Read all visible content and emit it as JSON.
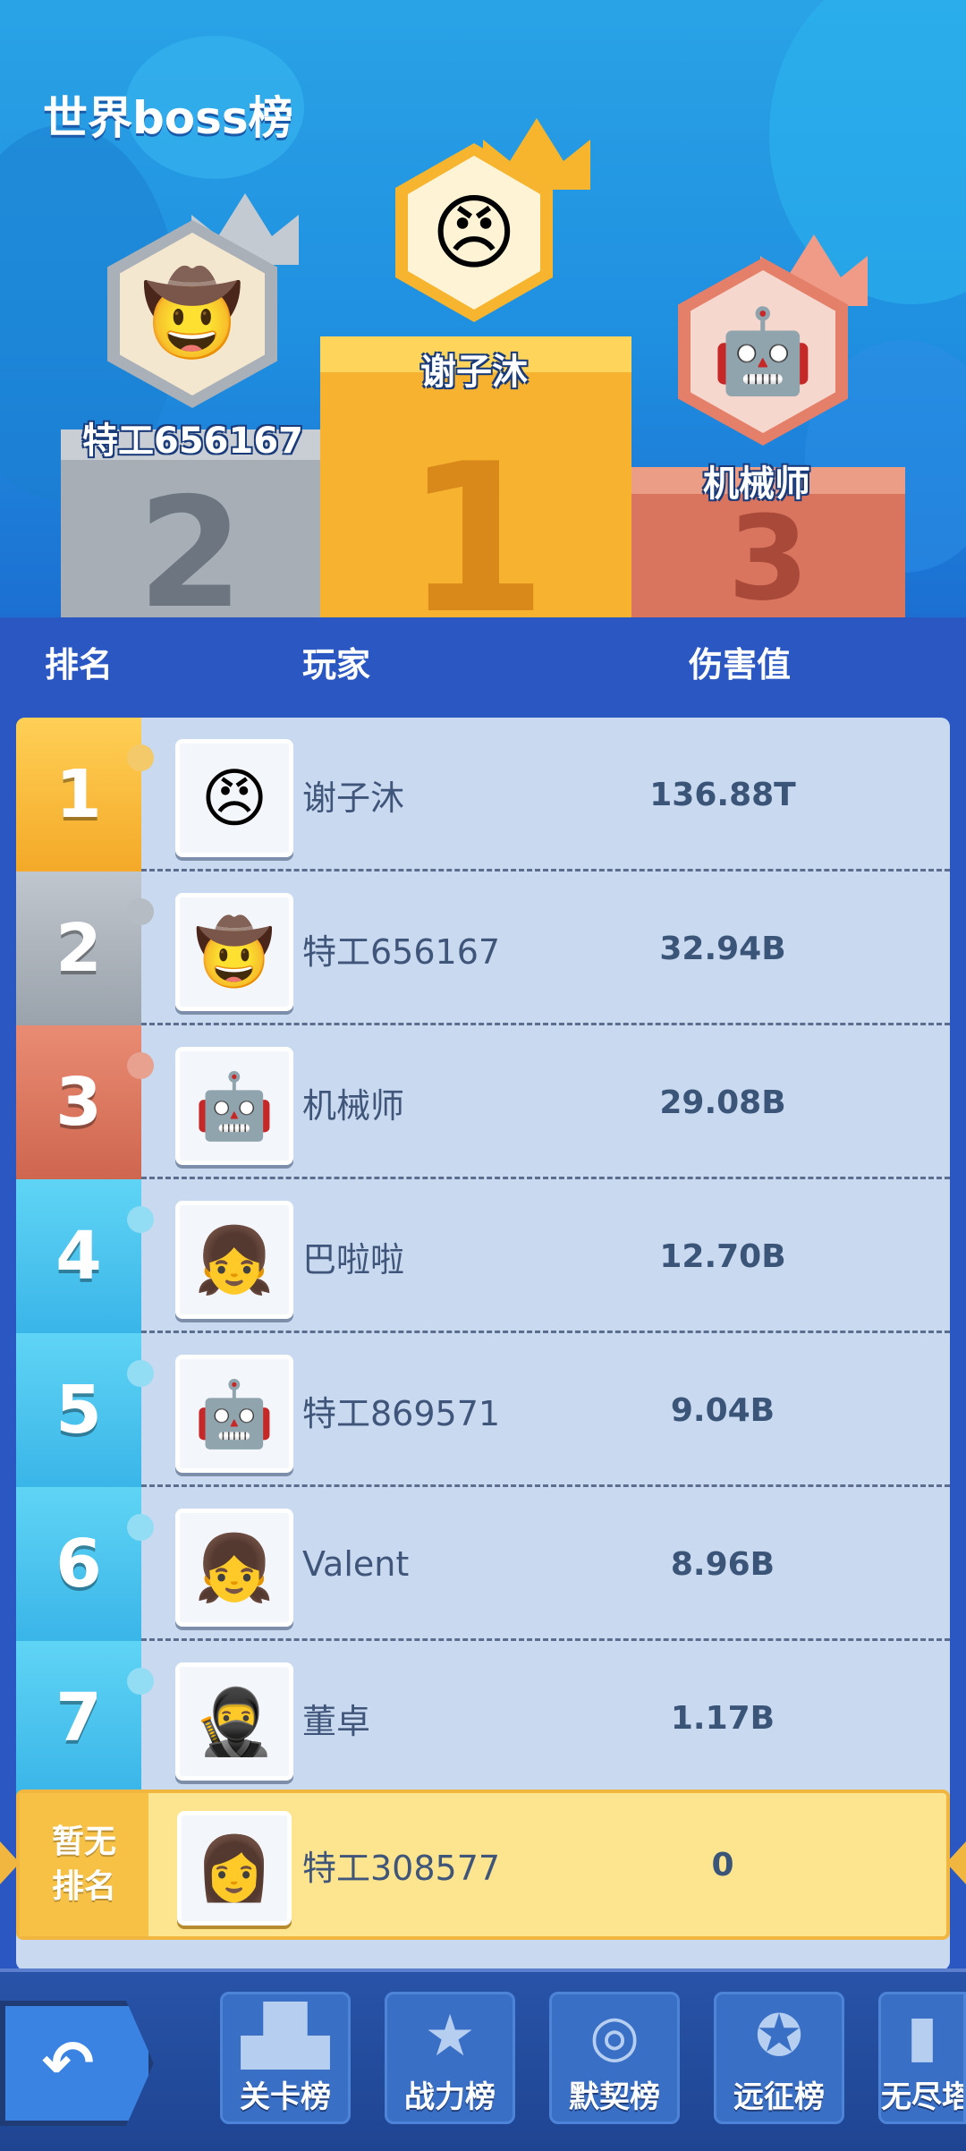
{
  "header": {
    "title": "世界boss榜"
  },
  "podium": [
    {
      "rank": "1",
      "name": "谢子沐",
      "avatar_icon": "cartoon-boy-tiger-hat-icon"
    },
    {
      "rank": "2",
      "name": "特工656167",
      "avatar_icon": "cowgirl-heart-eyepatch-icon"
    },
    {
      "rank": "3",
      "name": "机械师",
      "avatar_icon": "red-robot-icon"
    }
  ],
  "columns": {
    "rank": "排名",
    "player": "玩家",
    "damage": "伤害值"
  },
  "rows": [
    {
      "rank": "1",
      "name": "谢子沐",
      "damage": "136.88T",
      "avatar_icon": "cartoon-boy-tiger-hat-icon"
    },
    {
      "rank": "2",
      "name": "特工656167",
      "damage": "32.94B",
      "avatar_icon": "cowgirl-heart-eyepatch-icon"
    },
    {
      "rank": "3",
      "name": "机械师",
      "damage": "29.08B",
      "avatar_icon": "red-robot-icon"
    },
    {
      "rank": "4",
      "name": "巴啦啦",
      "damage": "12.70B",
      "avatar_icon": "girl-with-bird-icon"
    },
    {
      "rank": "5",
      "name": "特工869571",
      "damage": "9.04B",
      "avatar_icon": "red-robot-icon"
    },
    {
      "rank": "6",
      "name": "Valent",
      "damage": "8.96B",
      "avatar_icon": "girl-with-bird-icon"
    },
    {
      "rank": "7",
      "name": "董卓",
      "damage": "1.17B",
      "avatar_icon": "purple-hair-swordsman-icon"
    }
  ],
  "my_row": {
    "rank_line1": "暂无",
    "rank_line2": "排名",
    "name": "特工308577",
    "damage": "0",
    "avatar_icon": "red-hair-gunner-icon"
  },
  "nav": {
    "back_icon": "back-arrow-icon",
    "tabs": [
      {
        "label": "关卡榜",
        "icon": "podium-icon"
      },
      {
        "label": "战力榜",
        "icon": "trophy-star-icon"
      },
      {
        "label": "默契榜",
        "icon": "medal-icon"
      },
      {
        "label": "远征榜",
        "icon": "badge-icon"
      },
      {
        "label": "无尽塔",
        "icon": "tower-icon"
      }
    ]
  },
  "colors": {
    "rank1": "#f8b731",
    "rank2": "#a9b0b8",
    "rank3": "#d97460",
    "rank_other": "#4ec7ef",
    "my_row_bg": "#fde58f",
    "panel": "#c9d9ef"
  }
}
